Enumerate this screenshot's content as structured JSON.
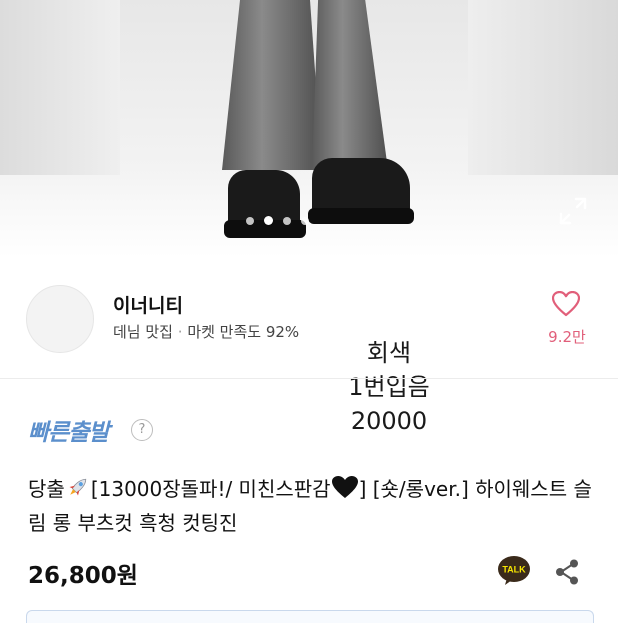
{
  "shop": {
    "name": "이너니티",
    "tagline": "데님 맛집",
    "separator": "·",
    "satisfaction": "마켓 만족도 92%",
    "likes": "9.2만"
  },
  "note_lines": [
    "회색",
    "1번입음",
    "20000"
  ],
  "badge": {
    "fast_shipping": "빠른출발",
    "help": "?"
  },
  "product": {
    "title_part1": "당출",
    "title_part2": "[13000장돌파!/ 미친스판감",
    "title_part3": "] [숏/롱ver.] 하이웨스트 슬림 롱 부츠컷 흑청 컷팅진",
    "price": "26,800원"
  },
  "icons": {
    "expand": "expand-icon",
    "heart": "heart-icon",
    "talk": "kakaotalk-icon",
    "talk_label": "TALK",
    "share": "share-icon",
    "rocket": "rocket-emoji",
    "black_heart": "black-heart-emoji"
  },
  "carousel": {
    "count": 4,
    "active_index": 1
  },
  "colors": {
    "likes": "#e15f7a",
    "fast_shipping": "#5b8fcc",
    "talk_bg": "#3a2a1a"
  }
}
